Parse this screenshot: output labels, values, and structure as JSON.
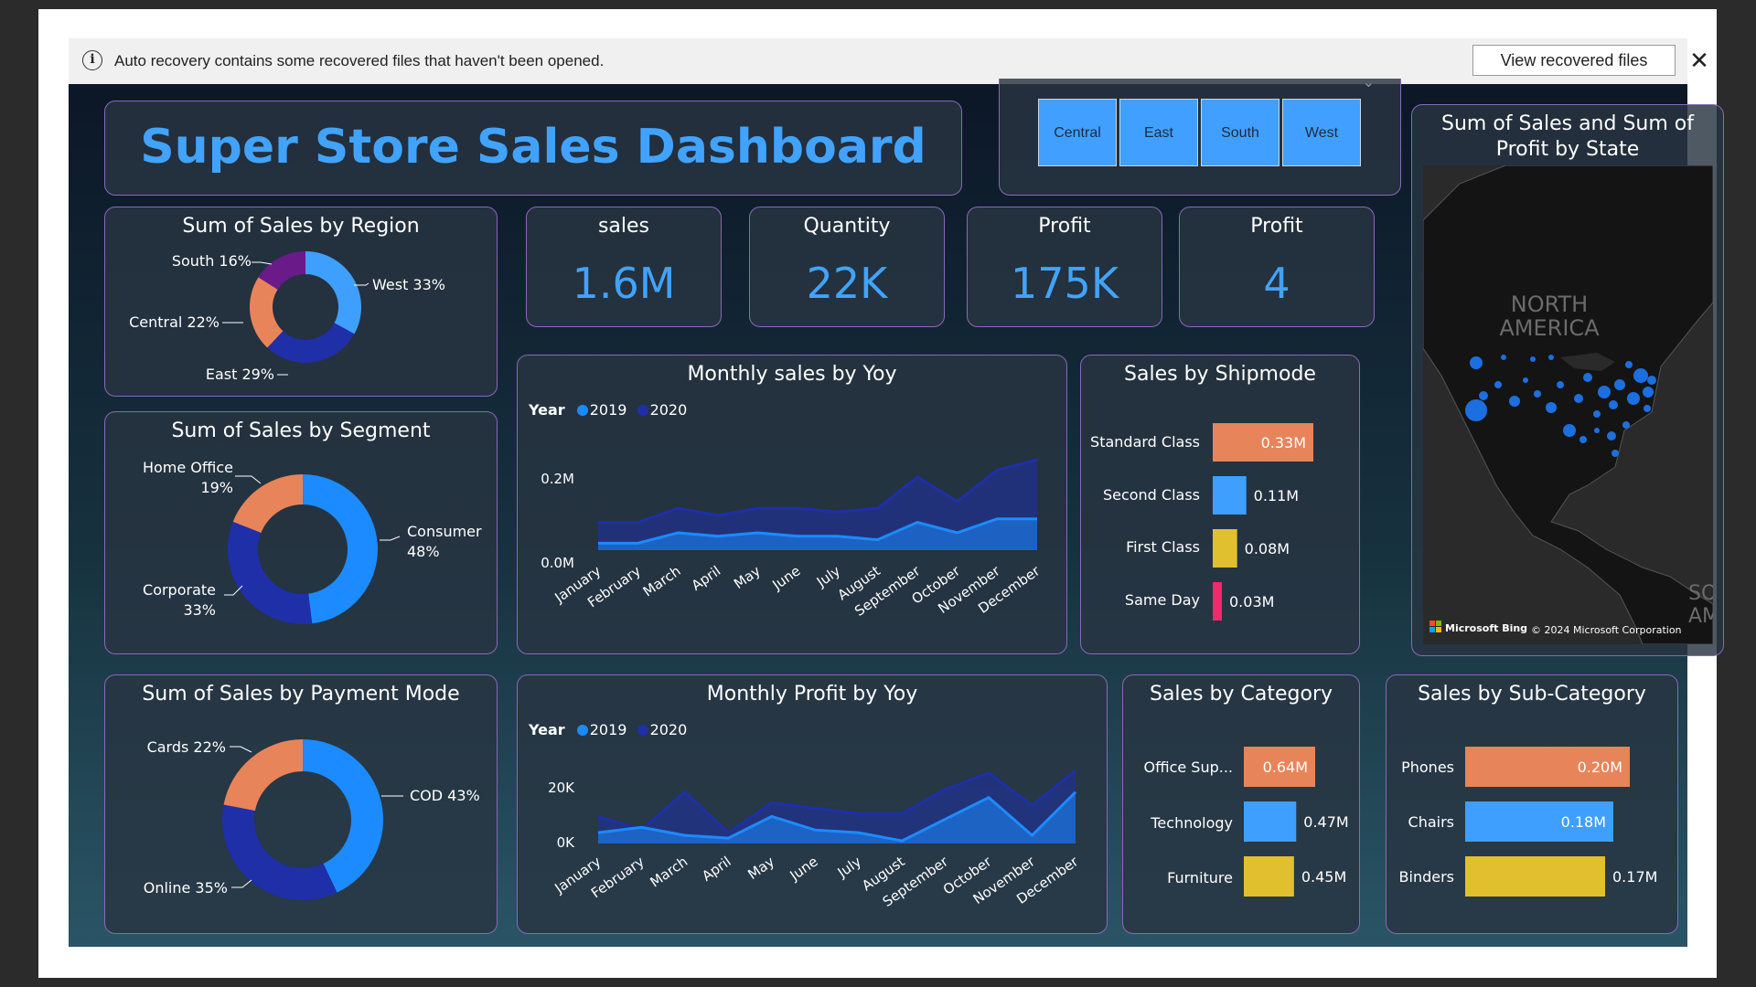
{
  "banner": {
    "message": "Auto recovery contains some recovered files that haven't been opened.",
    "button_label": "View recovered files",
    "info_icon": "i",
    "close_icon": "✕"
  },
  "dashboard": {
    "title": "Super Store Sales Dashboard"
  },
  "slicer": {
    "options": [
      "Central",
      "East",
      "South",
      "West"
    ],
    "chevron": "⌄"
  },
  "kpis": [
    {
      "label": "sales",
      "value": "1.6M"
    },
    {
      "label": "Quantity",
      "value": "22K"
    },
    {
      "label": "Profit",
      "value": "175K"
    },
    {
      "label": "Profit",
      "value": "4"
    }
  ],
  "colors": {
    "series_2019": "#1c8bff",
    "series_2020": "#1e2fa8",
    "orange": "#e8845a",
    "light_blue": "#3f9fff",
    "yellow": "#e0c02e",
    "magenta": "#f02a6b",
    "purple": "#6b1a8a",
    "kpi_value": "#41a3ff"
  },
  "map": {
    "title_line1": "Sum of Sales and Sum of",
    "title_line2": "Profit by State",
    "region_label_1": "NORTH",
    "region_label_2": "AMERICA",
    "edge_label_1": "SO",
    "edge_label_2": "AM",
    "bing_text": "Microsoft Bing",
    "copyright": "© 2024 Microsoft Corporation"
  },
  "region_chart": {
    "title": "Sum of Sales by Region",
    "labels": [
      "West 33%",
      "East 29%",
      "Central 22%",
      "South 16%"
    ]
  },
  "segment_chart": {
    "title": "Sum of Sales by Segment",
    "labels": {
      "consumer_1": "Consumer",
      "consumer_2": "48%",
      "corporate_1": "Corporate",
      "corporate_2": "33%",
      "home_1": "Home Office",
      "home_2": "19%"
    }
  },
  "payment_chart": {
    "title": "Sum of Sales by Payment Mode",
    "labels": [
      "COD 43%",
      "Online 35%",
      "Cards 22%"
    ]
  },
  "sales_line": {
    "title": "Monthly sales by Yoy",
    "legend_title": "Year",
    "series_names": [
      "2019",
      "2020"
    ],
    "y_ticks": [
      "0.2M",
      "0.0M"
    ],
    "months": [
      "January",
      "February",
      "March",
      "April",
      "May",
      "June",
      "July",
      "August",
      "September",
      "October",
      "November",
      "December"
    ]
  },
  "profit_line": {
    "title": "Monthly Profit by Yoy",
    "legend_title": "Year",
    "series_names": [
      "2019",
      "2020"
    ],
    "y_ticks": [
      "20K",
      "0K"
    ],
    "months": [
      "January",
      "February",
      "March",
      "April",
      "May",
      "June",
      "July",
      "August",
      "September",
      "October",
      "November",
      "December"
    ]
  },
  "shipmode": {
    "title": "Sales by Shipmode",
    "labels": [
      "Standard Class",
      "Second Class",
      "First Class",
      "Same Day"
    ],
    "value_labels": [
      "0.33M",
      "0.11M",
      "0.08M",
      "0.03M"
    ]
  },
  "category": {
    "title": "Sales by Category",
    "labels": [
      "Office Sup...",
      "Technology",
      "Furniture"
    ],
    "value_labels": [
      "0.64M",
      "0.47M",
      "0.45M"
    ]
  },
  "subcategory": {
    "title": "Sales by Sub-Category",
    "labels": [
      "Phones",
      "Chairs",
      "Binders"
    ],
    "value_labels": [
      "0.20M",
      "0.18M",
      "0.17M"
    ]
  },
  "chart_data": [
    {
      "type": "pie",
      "title": "Sum of Sales by Region",
      "categories": [
        "West",
        "East",
        "Central",
        "South"
      ],
      "values": [
        33,
        29,
        22,
        16
      ]
    },
    {
      "type": "pie",
      "title": "Sum of Sales by Segment",
      "categories": [
        "Consumer",
        "Corporate",
        "Home Office"
      ],
      "values": [
        48,
        33,
        19
      ]
    },
    {
      "type": "pie",
      "title": "Sum of Sales by Payment Mode",
      "categories": [
        "COD",
        "Online",
        "Cards"
      ],
      "values": [
        43,
        35,
        22
      ]
    },
    {
      "type": "area",
      "title": "Monthly sales by Yoy",
      "categories": [
        "January",
        "February",
        "March",
        "April",
        "May",
        "June",
        "July",
        "August",
        "September",
        "October",
        "November",
        "December"
      ],
      "series": [
        {
          "name": "2019",
          "values": [
            0.02,
            0.02,
            0.05,
            0.04,
            0.05,
            0.04,
            0.04,
            0.03,
            0.08,
            0.05,
            0.09,
            0.09
          ]
        },
        {
          "name": "2020",
          "values": [
            0.08,
            0.08,
            0.12,
            0.1,
            0.12,
            0.12,
            0.11,
            0.12,
            0.21,
            0.14,
            0.23,
            0.26
          ]
        }
      ],
      "ylim": [
        0,
        0.26
      ]
    },
    {
      "type": "area",
      "title": "Monthly Profit by Yoy",
      "categories": [
        "January",
        "February",
        "March",
        "April",
        "May",
        "June",
        "July",
        "August",
        "September",
        "October",
        "November",
        "December"
      ],
      "series": [
        {
          "name": "2019",
          "values": [
            4000,
            6000,
            3000,
            2000,
            10000,
            5000,
            4000,
            1000,
            9000,
            17000,
            3000,
            19000
          ]
        },
        {
          "name": "2020",
          "values": [
            10000,
            5000,
            19000,
            4000,
            15000,
            13000,
            11000,
            11000,
            20000,
            26000,
            14000,
            27000
          ]
        }
      ],
      "ylim": [
        0,
        27000
      ]
    },
    {
      "type": "bar",
      "title": "Sales by Shipmode",
      "categories": [
        "Standard Class",
        "Second Class",
        "First Class",
        "Same Day"
      ],
      "values": [
        0.33,
        0.11,
        0.08,
        0.03
      ]
    },
    {
      "type": "bar",
      "title": "Sales by Category",
      "categories": [
        "Office Sup...",
        "Technology",
        "Furniture"
      ],
      "values": [
        0.64,
        0.47,
        0.45
      ]
    },
    {
      "type": "bar",
      "title": "Sales by Sub-Category",
      "categories": [
        "Phones",
        "Chairs",
        "Binders"
      ],
      "values": [
        0.2,
        0.18,
        0.17
      ]
    }
  ]
}
